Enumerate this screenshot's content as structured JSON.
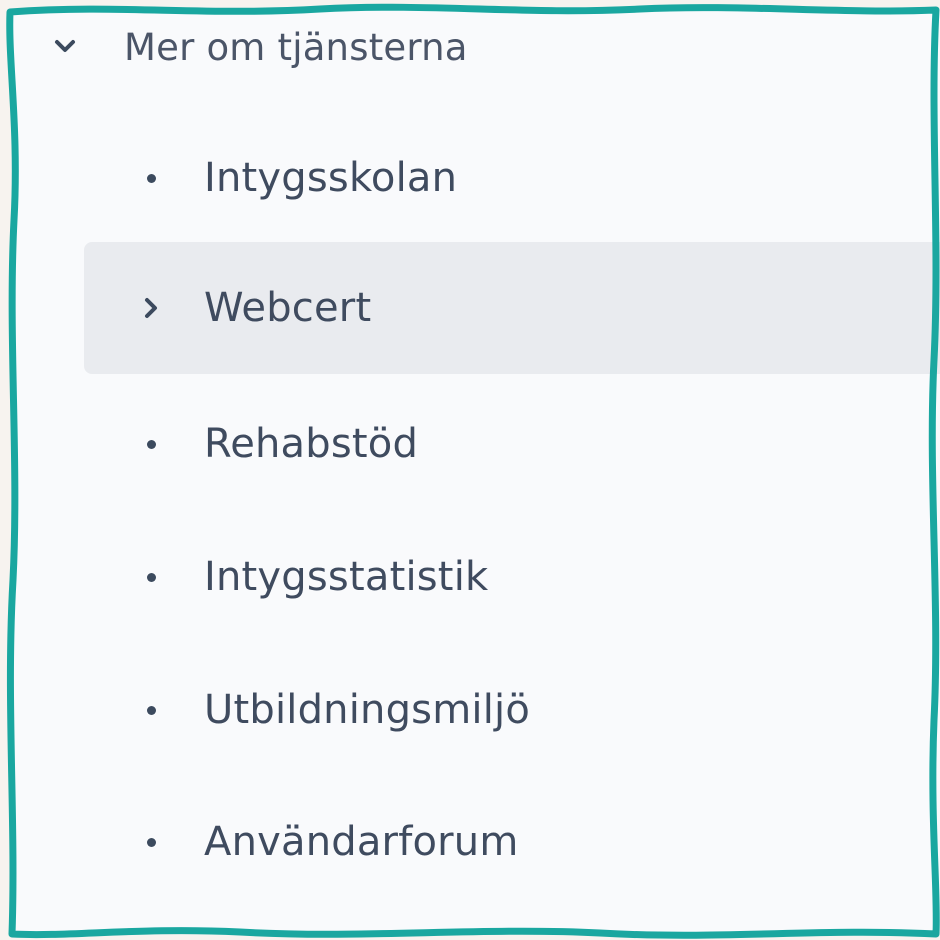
{
  "section": {
    "title": "Mer om tjänsterna",
    "expand_icon": "chevron-down-icon"
  },
  "items": [
    {
      "label": "Intygsskolan",
      "marker": "bullet",
      "active": false
    },
    {
      "label": "Webcert",
      "marker": "chevron-right-icon",
      "active": true
    },
    {
      "label": "Rehabstöd",
      "marker": "bullet",
      "active": false
    },
    {
      "label": "Intygsstatistik",
      "marker": "bullet",
      "active": false
    },
    {
      "label": "Utbildningsmiljö",
      "marker": "bullet",
      "active": false
    },
    {
      "label": "Användarforum",
      "marker": "bullet",
      "active": false
    }
  ],
  "colors": {
    "border": "#1aa7a0",
    "panel_background": "#f9fafc",
    "active_background": "#e9ebef",
    "text": "#3f4b5f"
  }
}
